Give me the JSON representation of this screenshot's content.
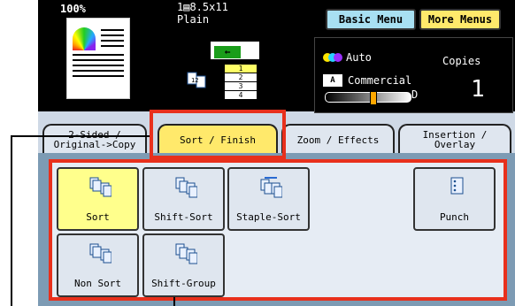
{
  "status": {
    "zoom": "100%",
    "paper_size": "1▤8.5x11",
    "paper_type": "Plain",
    "trays": [
      "1",
      "2",
      "3",
      "4"
    ],
    "selected_tray": "1"
  },
  "menus": {
    "basic": "Basic Menu",
    "more": "More Menus"
  },
  "info": {
    "tone": "Auto",
    "original_type": "Commercial",
    "copies_label": "Copies",
    "copies": "1",
    "density_level": 0.55
  },
  "tabs": [
    {
      "label": "2-Sided /\nOriginal->Copy",
      "active": false
    },
    {
      "label": "Sort / Finish",
      "active": true
    },
    {
      "label": "Zoom / Effects",
      "active": false
    },
    {
      "label": "Insertion /\nOverlay",
      "active": false
    }
  ],
  "options": [
    {
      "label": "Sort",
      "selected": true,
      "icon": "sort-icon"
    },
    {
      "label": "Shift-Sort",
      "selected": false,
      "icon": "shift-sort-icon"
    },
    {
      "label": "Staple-Sort",
      "selected": false,
      "icon": "staple-sort-icon"
    },
    {
      "label": "Punch",
      "selected": false,
      "icon": "punch-icon"
    },
    {
      "label": "Non Sort",
      "selected": false,
      "icon": "non-sort-icon"
    },
    {
      "label": "Shift-Group",
      "selected": false,
      "icon": "shift-group-icon"
    }
  ],
  "colors": {
    "accent_yellow": "#ffe96b",
    "callout_red": "#e8301c",
    "basic_blue": "#a8e0f2"
  }
}
